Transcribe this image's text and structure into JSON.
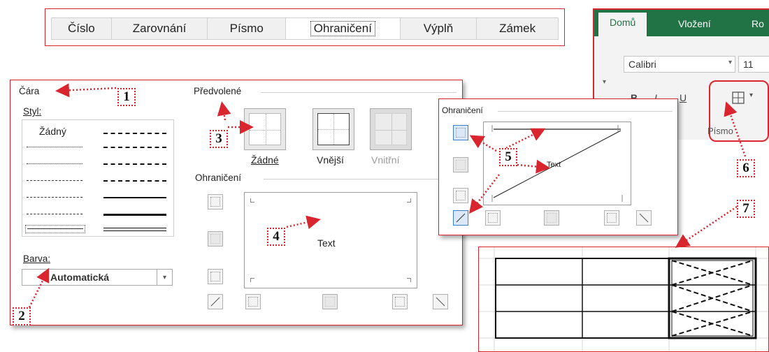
{
  "tabs": [
    "Číslo",
    "Zarovnání",
    "Písmo",
    "Ohraničení",
    "Výplň",
    "Zámek"
  ],
  "ribbon": {
    "tabs": [
      "Domů",
      "Vložení",
      "Ro"
    ],
    "font_name": "Calibri",
    "font_size": "11",
    "bold": "B",
    "italic": "I",
    "underline": "U",
    "group_label": "Písmo"
  },
  "line": {
    "group": "Čára",
    "style_label": "Styl:",
    "none_label": "Žádný",
    "color_label": "Barva:",
    "color_value": "Automatická"
  },
  "presets": {
    "group": "Předvolené",
    "none": "Žádné",
    "outer": "Vnější",
    "inner": "Vnitřní"
  },
  "border": {
    "group": "Ohraničení",
    "preview_text": "Text"
  },
  "small_dialog": {
    "group": "Ohraničení",
    "preview_text": "Text"
  },
  "badges": [
    "1",
    "2",
    "3",
    "4",
    "5",
    "6",
    "7"
  ],
  "colors": {
    "accent_red": "#d9262e",
    "excel_green": "#217346"
  }
}
